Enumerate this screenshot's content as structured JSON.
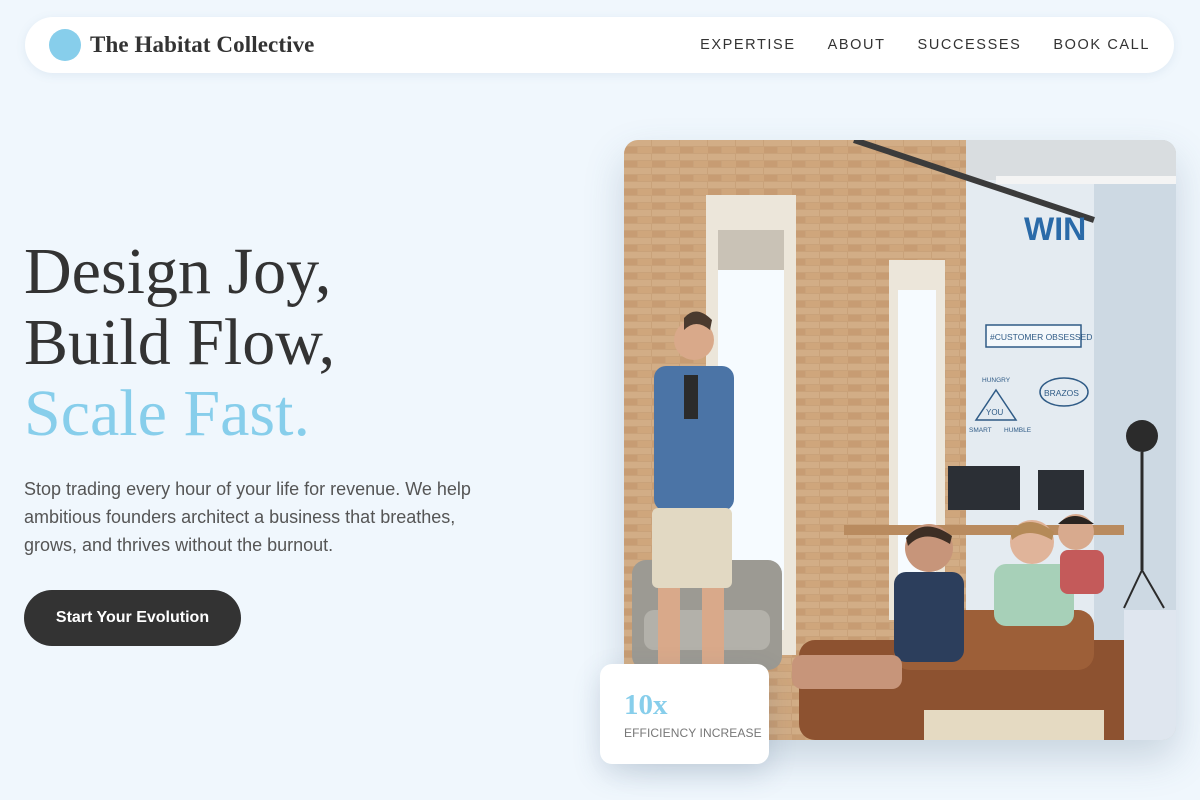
{
  "brand": {
    "name": "The Habitat Collective",
    "accent_color": "#87ceeb"
  },
  "nav": {
    "items": [
      {
        "label": "EXPERTISE"
      },
      {
        "label": "ABOUT"
      },
      {
        "label": "SUCCESSES"
      },
      {
        "label": "BOOK CALL"
      }
    ]
  },
  "hero": {
    "title_line1": "Design Joy,",
    "title_line2": "Build Flow,",
    "title_line3": "Scale Fast.",
    "subtitle": "Stop trading every hour of your life for revenue. We help ambitious founders architect a business that breathes, grows, and thrives without the burnout.",
    "cta_label": "Start Your Evolution"
  },
  "image": {
    "mural_text": "WIN",
    "mural_badge_1": "#CUSTOMER OBSESSED",
    "mural_badge_2": "BRAZOS",
    "mural_badge_3": "YOU",
    "mural_small_1": "HUNGRY",
    "mural_small_2": "SMART",
    "mural_small_3": "HUMBLE"
  },
  "stat": {
    "value": "10x",
    "label": "EFFICIENCY INCREASE"
  },
  "colors": {
    "background": "#f0f7fd",
    "dark": "#333333",
    "accent": "#87ceeb"
  }
}
